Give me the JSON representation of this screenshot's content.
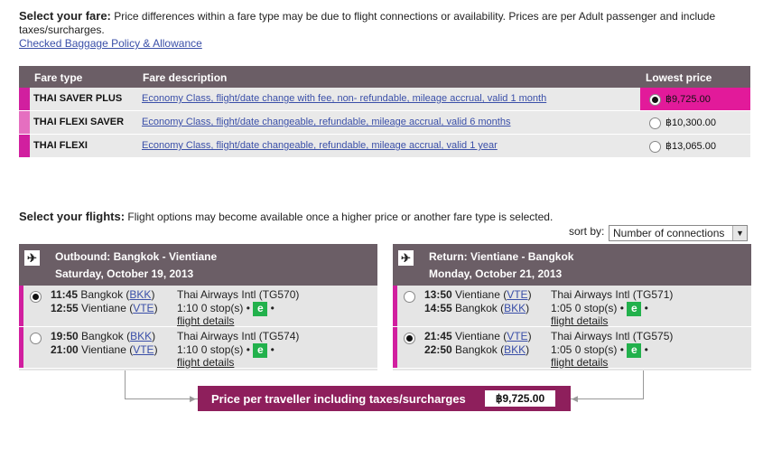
{
  "fare_section": {
    "heading": "Select your fare:",
    "intro": "Price differences within a fare type may be due to flight connections or availability. Prices are per Adult passenger and include taxes/surcharges.",
    "baggage_link": "Checked Baggage Policy & Allowance",
    "columns": {
      "type": "Fare type",
      "description": "Fare description",
      "price": "Lowest price"
    },
    "fares": [
      {
        "name": "THAI SAVER PLUS",
        "description": "Economy Class, flight/date change with fee, non- refundable, mileage accrual, valid 1 month",
        "price": "฿9,725.00",
        "selected": true
      },
      {
        "name": "THAI FLEXI SAVER",
        "description": "Economy Class, flight/date changeable, refundable, mileage accrual, valid 6 months",
        "price": "฿10,300.00",
        "selected": false
      },
      {
        "name": "THAI FLEXI",
        "description": "Economy Class, flight/date changeable, refundable, mileage accrual, valid 1 year",
        "price": "฿13,065.00",
        "selected": false
      }
    ]
  },
  "flights_section": {
    "heading": "Select your flights:",
    "intro": "Flight options may become available once a higher price or another fare type is selected.",
    "sort_label": "sort by:",
    "sort_value": "Number of connections"
  },
  "outbound": {
    "route": "Outbound: Bangkok - Vientiane",
    "date": "Saturday, October 19, 2013",
    "options": [
      {
        "dep_time": "11:45",
        "dep_city": "Bangkok",
        "dep_code": "BKK",
        "arr_time": "12:55",
        "arr_city": "Vientiane",
        "arr_code": "VTE",
        "airline": "Thai Airways Intl (TG570)",
        "duration": "1:10",
        "stops": "0 stop(s)",
        "details": "flight details",
        "selected": true
      },
      {
        "dep_time": "19:50",
        "dep_city": "Bangkok",
        "dep_code": "BKK",
        "arr_time": "21:00",
        "arr_city": "Vientiane",
        "arr_code": "VTE",
        "airline": "Thai Airways Intl (TG574)",
        "duration": "1:10",
        "stops": "0 stop(s)",
        "details": "flight details",
        "selected": false
      }
    ]
  },
  "return": {
    "route": "Return: Vientiane - Bangkok",
    "date": "Monday, October 21, 2013",
    "options": [
      {
        "dep_time": "13:50",
        "dep_city": "Vientiane",
        "dep_code": "VTE",
        "arr_time": "14:55",
        "arr_city": "Bangkok",
        "arr_code": "BKK",
        "airline": "Thai Airways Intl (TG571)",
        "duration": "1:05",
        "stops": "0 stop(s)",
        "details": "flight details",
        "selected": false
      },
      {
        "dep_time": "21:45",
        "dep_city": "Vientiane",
        "dep_code": "VTE",
        "arr_time": "22:50",
        "arr_city": "Bangkok",
        "arr_code": "BKK",
        "airline": "Thai Airways Intl (TG575)",
        "duration": "1:05",
        "stops": "0 stop(s)",
        "details": "flight details",
        "selected": true
      }
    ]
  },
  "eticket_badge": "e",
  "bullet": "•",
  "price_bar": {
    "label": "Price per traveller including taxes/surcharges",
    "value": "฿9,725.00"
  },
  "icons": {
    "plane": "plane-icon"
  },
  "colors": {
    "header_bg": "#6b5e66",
    "accent_magenta": "#d11f9f",
    "price_bar_bg": "#8e1f5c",
    "eticket_green": "#22b14c",
    "link": "#3a4fa8"
  }
}
